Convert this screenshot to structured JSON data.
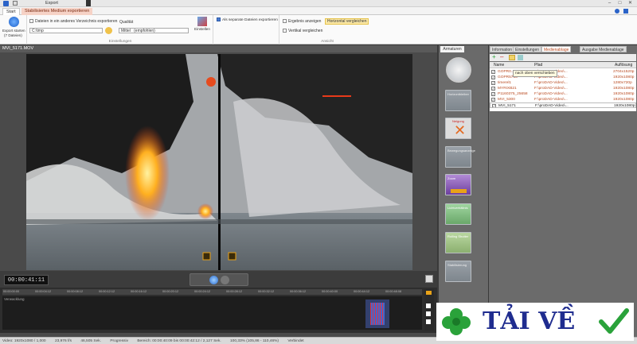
{
  "title_bar": {
    "context_label": "Export"
  },
  "tabs": [
    {
      "label": "Start"
    },
    {
      "label": "Stabilisiertes Medium exportieren"
    }
  ],
  "ribbon": {
    "export_button": {
      "line1": "Export starten",
      "line2": "(7 Dateien)"
    },
    "export_group": {
      "checkbox_label": "Dateien in ein anderes Verzeichnis exportieren",
      "path_value": "C:\\tmp",
      "quality_label": "Qualität",
      "quality_value": "Mittel",
      "quality_hint": "(empfohlen)",
      "settings_button": "Einstellen",
      "group_label": "Einstellungen"
    },
    "separate_label": "Als separate Dateien exportieren",
    "view_group": {
      "show_results": "Ergebnis anzeigen",
      "compare_horizontal": "Horizontal vergleichen",
      "compare_vertical": "Vertikal vergleichen",
      "group_label": "Ansicht"
    }
  },
  "video": {
    "filename": "MVI_5171.MOV",
    "timecode": "00:00:41:11"
  },
  "timeline": {
    "ticks": [
      "00:00:00:00",
      "00:00:04:12",
      "00:00:08:12",
      "00:00:12:12",
      "00:00:16:12",
      "00:00:20:12",
      "00:00:24:12",
      "00:00:28:12",
      "00:00:32:12",
      "00:00:36:12",
      "00:00:40:00",
      "00:00:44:12",
      "00:00:48:08"
    ],
    "track_label": "Verwacklung"
  },
  "middle": {
    "header": "Armaturen",
    "tiles": [
      "",
      "Horizontbleiber",
      "Neigung",
      "Bewegungsanzeige",
      "Zoom",
      "Lichtverhältnis",
      "Rolling Shutter",
      "Stabilisierung"
    ]
  },
  "right": {
    "tabs": [
      "Information",
      "Einstellungen",
      "Medienablage",
      "Ausgabe Medienablage"
    ],
    "columns": [
      "Name",
      "Pfad",
      "Auflösung"
    ],
    "tooltip": "nach oben verschieben",
    "rows": [
      {
        "name": "GOPR0...",
        "path": "F:\\proDAD-Video\\...",
        "res": "2704x1520p"
      },
      {
        "name": "GOPR5766",
        "path": "F:\\proDAD-Video\\...",
        "res": "1920x1080p"
      },
      {
        "name": "timerel1",
        "path": "F:\\proDAD-Video\\...",
        "res": "1280x720p"
      },
      {
        "name": "MYRIXB21",
        "path": "F:\\proDAD-Video\\...",
        "res": "1920x1080p"
      },
      {
        "name": "P1160375_25658",
        "path": "F:\\proDAD-Video\\...",
        "res": "1920x1080p"
      },
      {
        "name": "MVI_5300",
        "path": "F:\\proDAD-Video\\...",
        "res": "1920x1080p"
      },
      {
        "name": "MVI_5171",
        "path": "F:\\proDAD-Video\\...",
        "res": "1920x1080p"
      }
    ]
  },
  "status": {
    "video": "Video: 1920x1080 / 1,000",
    "fps": "23,976 f/s",
    "duration": "46,505 Sek.",
    "progress": "Progressiv",
    "range": "Bereich: 00:00:40:09 bis 00:00:42:12 / 2,127 Sek.",
    "zoom": "100,33% (105,86 - 110,46%)",
    "state": "Verbindet"
  },
  "watermark": {
    "text": "TẢI VỀ"
  },
  "colors": {
    "accent": "#e8a218",
    "ctx_tab": "#f6d2c6",
    "lava": "#ff7a10",
    "wm_text": "#1f2c8f",
    "wm_green": "#2aa23a"
  }
}
